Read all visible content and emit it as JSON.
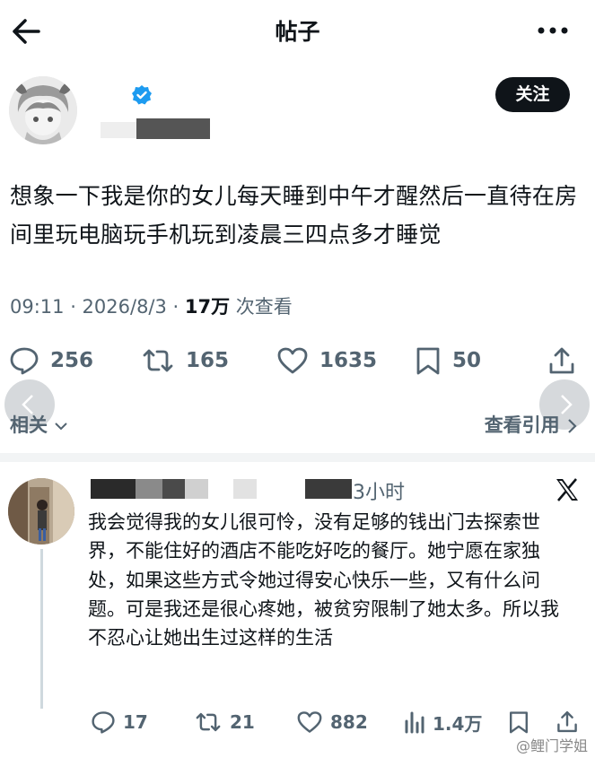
{
  "header": {
    "title": "帖子",
    "back_icon": "arrow-left-icon",
    "more_icon": "more-horizontal-icon"
  },
  "post": {
    "follow_label": "关注",
    "text": "想象一下我是你的女儿每天睡到中午才醒然后一直待在房间里玩电脑玩手机玩到凌晨三四点多才睡觉",
    "time": "09:11 · 2026/8/3 · ",
    "views": "17万",
    "views_suffix": " 次查看",
    "stats": {
      "replies": "256",
      "retweets": "165",
      "likes": "1635",
      "bookmarks": "50"
    },
    "related": "相关",
    "view_quotes": "查看引用"
  },
  "reply": {
    "time": "3小时",
    "text": "我会觉得我的女儿很可怜，没有足够的钱出门去探索世界，不能住好的酒店不能吃好吃的餐厅。她宁愿在家独处，如果这些方式令她过得安心快乐一些，又有什么问题。可是我还是很心疼她，被贫穷限制了她太多。所以我不忍心让她出生过这样的生活",
    "stats": {
      "replies": "17",
      "retweets": "21",
      "likes": "882",
      "views": "1.4万"
    }
  },
  "watermark": "@鲤门学姐",
  "colors": {
    "text": "#0f1419",
    "secondary": "#536471",
    "verified": "#1d9bf0",
    "follow_bg": "#0f1419"
  }
}
